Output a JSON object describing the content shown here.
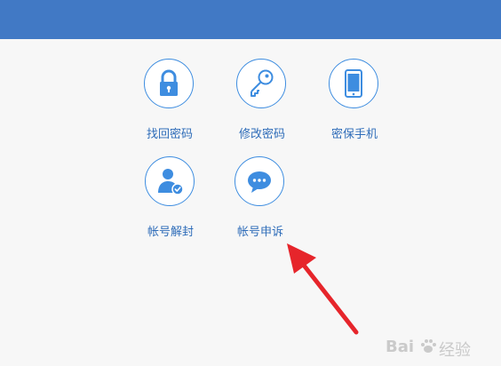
{
  "header": {
    "bar_color": "#4179c5"
  },
  "tiles": [
    {
      "label": "找回密码",
      "icon": "lock-icon"
    },
    {
      "label": "修改密码",
      "icon": "key-icon"
    },
    {
      "label": "密保手机",
      "icon": "phone-icon"
    },
    {
      "label": "帐号解封",
      "icon": "user-check-icon"
    },
    {
      "label": "帐号申诉",
      "icon": "chat-bubble-icon"
    }
  ],
  "colors": {
    "icon_blue": "#3e8de0",
    "label_blue": "#2f6db9",
    "arrow_red": "#e6252b",
    "background": "#f7f7f7"
  },
  "watermark": {
    "brand": "Bai",
    "suffix": "经验"
  }
}
